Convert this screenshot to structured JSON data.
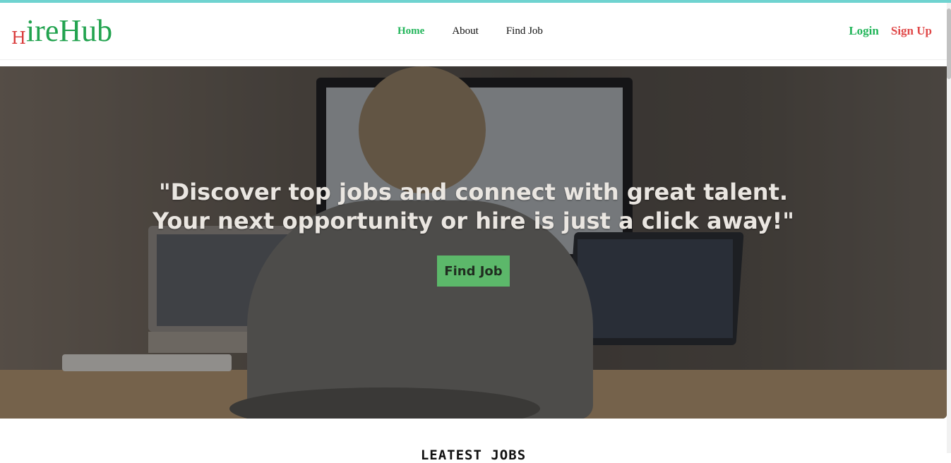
{
  "brand": {
    "logo_initial": "H",
    "logo_rest": "ireHub"
  },
  "nav": {
    "links": [
      {
        "label": "Home",
        "active": true
      },
      {
        "label": "About"
      },
      {
        "label": "Find Job"
      }
    ]
  },
  "auth": {
    "login": "Login",
    "signup": "Sign Up"
  },
  "hero": {
    "quote_line1": "\"Discover top jobs and connect with great talent.",
    "quote_line2": "Your next opportunity or hire is just a click away!\"",
    "cta_label": "Find Job"
  },
  "sections": {
    "latest_jobs_title": "LEATEST JOBS"
  },
  "colors": {
    "brand_green": "#22a34f",
    "brand_red": "#d93a3a",
    "accent_green": "#22b55a",
    "cta_green": "#5ec46e",
    "top_stripe": "#6fd3d0"
  }
}
